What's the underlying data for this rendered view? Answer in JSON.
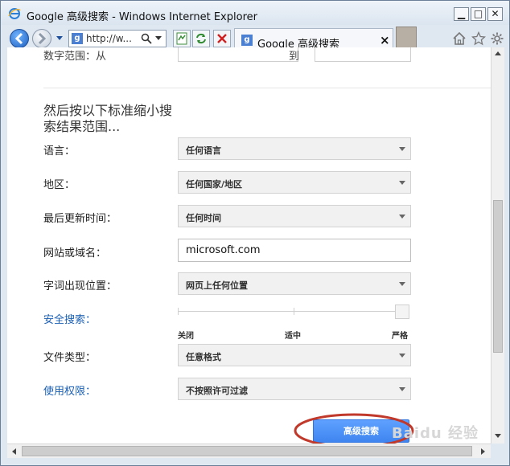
{
  "window": {
    "title": "Google 高级搜索 - Windows Internet Explorer"
  },
  "navbar": {
    "address_text": "http://w...",
    "tab_title": "Google 高级搜索",
    "tab_close": "×"
  },
  "top_partial": {
    "range_label": "数字范围：从",
    "range_to": "到"
  },
  "section": {
    "heading_line1": "然后按以下标准缩小搜",
    "heading_line2": "索结果范围..."
  },
  "rows": {
    "language": {
      "label": "语言：",
      "value": "任何语言"
    },
    "region": {
      "label": "地区：",
      "value": "任何国家/地区"
    },
    "last_update": {
      "label": "最后更新时间：",
      "value": "任何时间"
    },
    "site": {
      "label": "网站或域名：",
      "value": "microsoft.com"
    },
    "term_position": {
      "label": "字词出现位置：",
      "value": "网页上任何位置"
    },
    "safesearch": {
      "label": "安全搜索：",
      "options": [
        "关闭",
        "适中",
        "严格"
      ]
    },
    "file_type": {
      "label": "文件类型：",
      "value": "任意格式"
    },
    "usage_rights": {
      "label": "使用权限：",
      "value": "不按照许可过滤"
    }
  },
  "submit": {
    "label": "高级搜索"
  },
  "watermark": "Baidu 经验"
}
